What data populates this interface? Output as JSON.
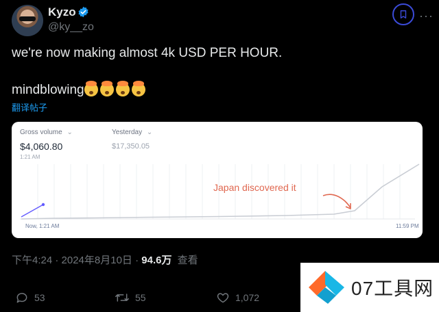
{
  "user": {
    "display_name": "Kyzo",
    "handle": "@ky__zo",
    "verified_icon": "verified-badge-icon"
  },
  "tweet": {
    "line1": "we're now making almost 4k USD PER HOUR.",
    "line2": "mindblowing",
    "emoji": [
      "exploding-head",
      "exploding-head",
      "exploding-head",
      "exploding-head"
    ],
    "translate_link": "翻译帖子"
  },
  "dashboard_card": {
    "metric1": {
      "label": "Gross volume",
      "value": "$4,060.80",
      "time": "1:21 AM"
    },
    "metric2": {
      "label": "Yesterday",
      "value": "$17,350.05"
    },
    "axis_start": "Now, 1:21 AM",
    "axis_end": "11:59 PM",
    "annotation": "Japan discovered it",
    "colors": {
      "today_line": "#635bff",
      "yesterday_line": "#c9cdd4",
      "annotation": "#e0674f"
    }
  },
  "meta": {
    "time_date": "下午4:24 · 2024年8月10日 · ",
    "views": "94.6万",
    "views_label": "查看"
  },
  "actions": {
    "replies": "53",
    "reposts": "55",
    "likes": "1,072"
  },
  "watermark": {
    "text": "07工具网"
  },
  "colors": {
    "background": "#000000",
    "text_primary": "#e7e9ea",
    "text_secondary": "#71767b",
    "link": "#1d9bf0",
    "bookmark_ring": "#3b4bd8"
  }
}
